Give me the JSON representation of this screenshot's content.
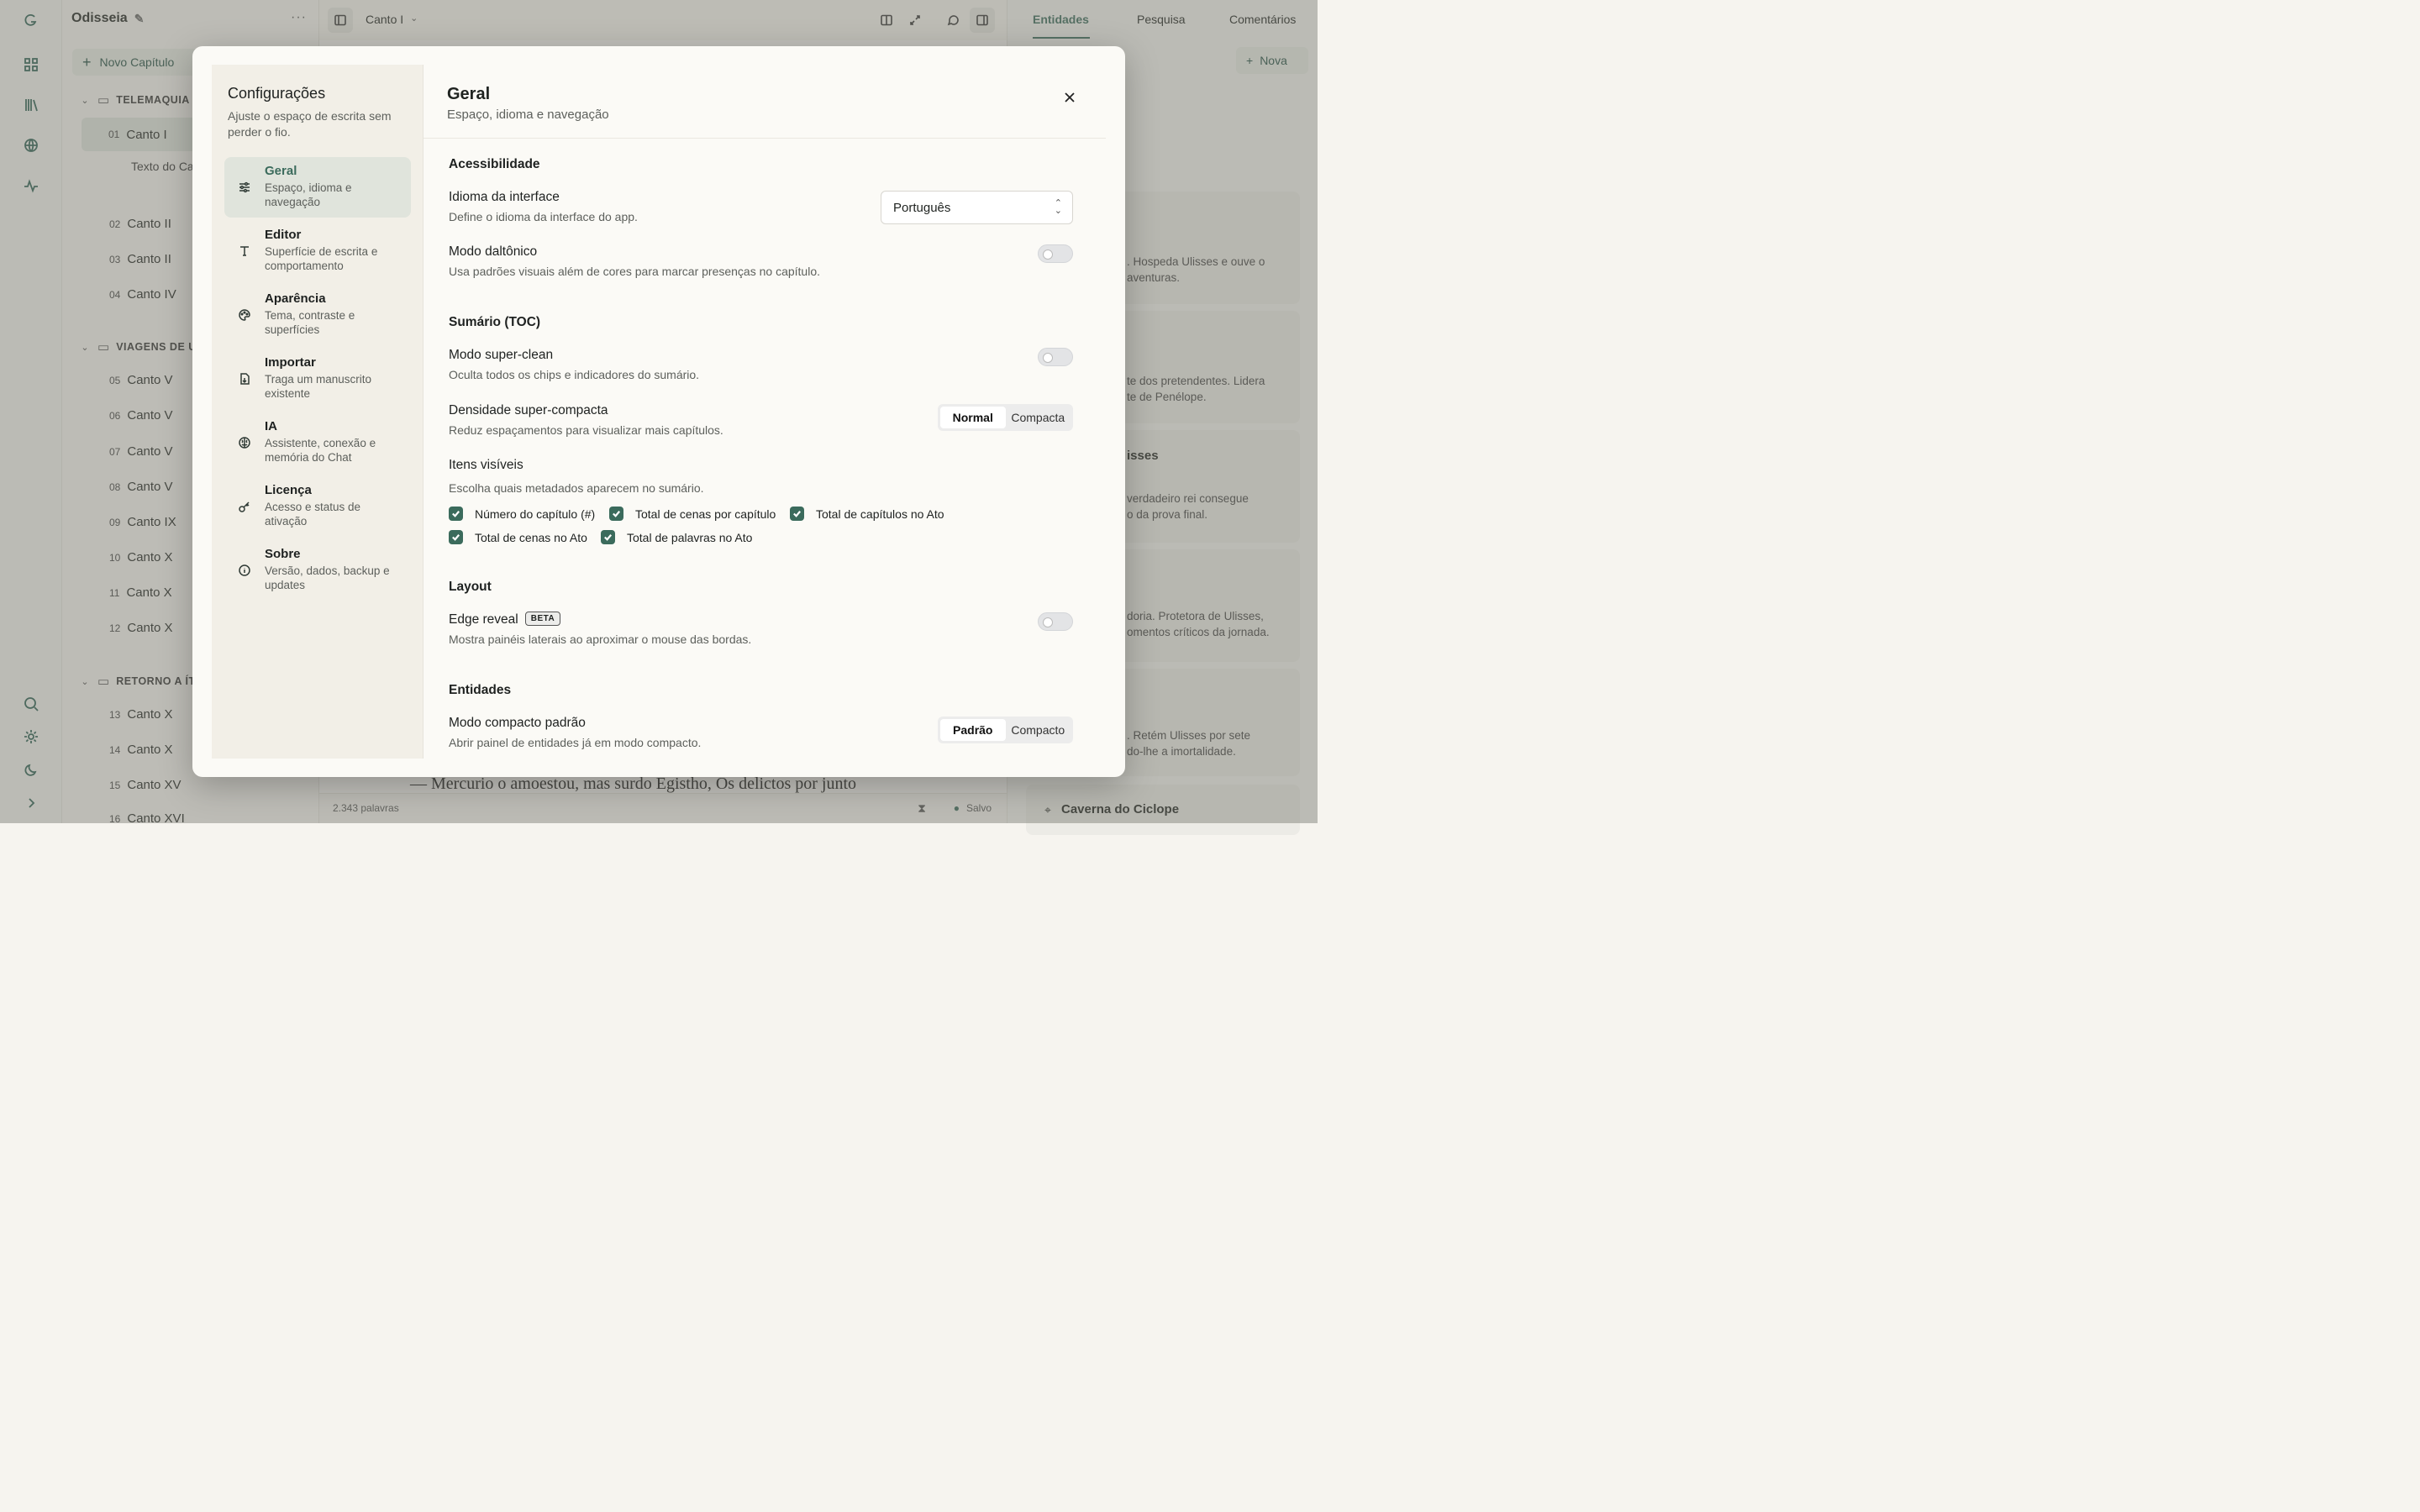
{
  "project": {
    "name": "Odisseia"
  },
  "sidebar": {
    "new_chapter": "Novo Capítulo",
    "acts": [
      {
        "label": "TELEMAQUIA"
      },
      {
        "label": "VIAGENS DE U"
      },
      {
        "label": "RETORNO A ÍT"
      }
    ],
    "chapters": [
      {
        "num": "01",
        "label": "Canto I"
      },
      {
        "num": "02",
        "label": "Canto II"
      },
      {
        "num": "03",
        "label": "Canto II"
      },
      {
        "num": "04",
        "label": "Canto IV"
      },
      {
        "num": "05",
        "label": "Canto V"
      },
      {
        "num": "06",
        "label": "Canto V"
      },
      {
        "num": "07",
        "label": "Canto V"
      },
      {
        "num": "08",
        "label": "Canto V"
      },
      {
        "num": "09",
        "label": "Canto IX"
      },
      {
        "num": "10",
        "label": "Canto X"
      },
      {
        "num": "11",
        "label": "Canto X"
      },
      {
        "num": "12",
        "label": "Canto X"
      },
      {
        "num": "13",
        "label": "Canto X"
      },
      {
        "num": "14",
        "label": "Canto X"
      },
      {
        "num": "15",
        "label": "Canto XV"
      },
      {
        "num": "16",
        "label": "Canto XVI"
      }
    ],
    "sub_item": "Texto do Ca"
  },
  "topbar": {
    "chapter": "Canto I"
  },
  "right_panel": {
    "tabs": [
      "Entidades",
      "Pesquisa",
      "Comentários"
    ],
    "new_button": "Nova",
    "cards": [
      {
        "text1": ". Hospeda Ulisses e ouve o",
        "text2": "aventuras."
      },
      {
        "text1": "te dos pretendentes. Lidera",
        "text2": "te de Penélope."
      },
      {
        "title": "isses",
        "text1": "verdadeiro rei consegue",
        "text2": "o da prova final."
      },
      {
        "text1": "doria. Protetora de Ulisses,",
        "text2": "omentos críticos da jornada."
      },
      {
        "text1": ". Retém Ulisses por sete",
        "text2": "do-lhe a imortalidade."
      }
    ],
    "last_card": "Caverna do Ciclope"
  },
  "editor": {
    "verse": "— Mercurio o amoestou, mas surdo Egistho, Os delictos por junto",
    "word_count": "2.343 palavras",
    "saved": "Salvo"
  },
  "settings": {
    "title": "Configurações",
    "subtitle": "Ajuste o espaço de escrita sem perder o fio.",
    "nav": [
      {
        "title": "Geral",
        "desc": "Espaço, idioma e navegação"
      },
      {
        "title": "Editor",
        "desc": "Superfície de escrita e comportamento"
      },
      {
        "title": "Aparência",
        "desc": "Tema, contraste e superfícies"
      },
      {
        "title": "Importar",
        "desc": "Traga um manuscrito existente"
      },
      {
        "title": "IA",
        "desc": "Assistente, conexão e memória do Chat"
      },
      {
        "title": "Licença",
        "desc": "Acesso e status de ativação"
      },
      {
        "title": "Sobre",
        "desc": "Versão, dados, backup e updates"
      }
    ],
    "page": {
      "title": "Geral",
      "subtitle": "Espaço, idioma e navegação",
      "accessibility": {
        "heading": "Acessibilidade",
        "language_label": "Idioma da interface",
        "language_desc": "Define o idioma da interface do app.",
        "language_value": "Português",
        "colorblind_label": "Modo daltônico",
        "colorblind_desc": "Usa padrões visuais além de cores para marcar presenças no capítulo."
      },
      "toc": {
        "heading": "Sumário (TOC)",
        "superclean_label": "Modo super-clean",
        "superclean_desc": "Oculta todos os chips e indicadores do sumário.",
        "density_label": "Densidade super-compacta",
        "density_desc": "Reduz espaçamentos para visualizar mais capítulos.",
        "density_options": [
          "Normal",
          "Compacta"
        ],
        "density_selected": "Normal",
        "visible_label": "Itens visíveis",
        "visible_desc": "Escolha quais metadados aparecem no sumário.",
        "visible_items": [
          "Número do capítulo (#)",
          "Total de cenas por capítulo",
          "Total de capítulos no Ato",
          "Total de cenas no Ato",
          "Total de palavras no Ato"
        ]
      },
      "layout": {
        "heading": "Layout",
        "edge_label": "Edge reveal",
        "edge_badge": "BETA",
        "edge_desc": "Mostra painéis laterais ao aproximar o mouse das bordas."
      },
      "entities": {
        "heading": "Entidades",
        "compact_label": "Modo compacto padrão",
        "compact_desc": "Abrir painel de entidades já em modo compacto.",
        "compact_options": [
          "Padrão",
          "Compacto"
        ],
        "compact_selected": "Padrão"
      }
    }
  },
  "colors": {
    "accent": "#3b6b5c"
  }
}
